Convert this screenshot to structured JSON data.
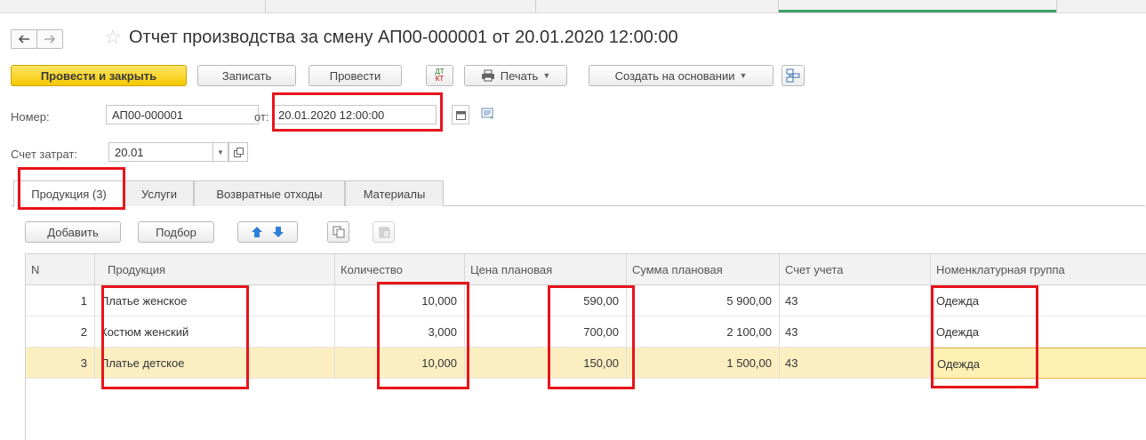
{
  "nav": {
    "back_icon": "arrow-left-icon",
    "forward_icon": "arrow-right-icon",
    "favorite_icon": "star-icon"
  },
  "document": {
    "title": "Отчет производства за смену АП00-000001 от 20.01.2020 12:00:00"
  },
  "toolbar": {
    "post_and_close": "Провести и закрыть",
    "save": "Записать",
    "post": "Провести",
    "dt_kt_top": "ДТ",
    "dt_kt_bottom": "КТ",
    "print": "Печать",
    "create_based_on": "Создать на основании"
  },
  "form": {
    "number_label": "Номер:",
    "number_value": "АП00-000001",
    "date_label": "от:",
    "date_value": "20.01.2020 12:00:00",
    "account_label": "Счет затрат:",
    "account_value": "20.01"
  },
  "tabs": [
    {
      "label": "Продукция (3)",
      "active": true
    },
    {
      "label": "Услуги",
      "active": false
    },
    {
      "label": "Возвратные отходы",
      "active": false
    },
    {
      "label": "Материалы",
      "active": false
    }
  ],
  "table_toolbar": {
    "add": "Добавить",
    "pick": "Подбор"
  },
  "table": {
    "columns": [
      "N",
      "Продукция",
      "Количество",
      "Цена плановая",
      "Сумма плановая",
      "Счет учета",
      "Номенклатурная группа"
    ],
    "rows": [
      {
        "n": "1",
        "product": "Платье женское",
        "qty": "10,000",
        "price": "590,00",
        "sum": "5 900,00",
        "account": "43",
        "group": "Одежда"
      },
      {
        "n": "2",
        "product": "Костюм женский",
        "qty": "3,000",
        "price": "700,00",
        "sum": "2 100,00",
        "account": "43",
        "group": "Одежда"
      },
      {
        "n": "3",
        "product": "Платье детское",
        "qty": "10,000",
        "price": "150,00",
        "sum": "1 500,00",
        "account": "43",
        "group": "Одежда"
      }
    ],
    "selected_row_index": 2
  },
  "colors": {
    "primary_button": "#f5c800",
    "selected_row": "#fbefc2",
    "highlight_box": "#e8141b",
    "tab_accent": "#3fa16a"
  }
}
